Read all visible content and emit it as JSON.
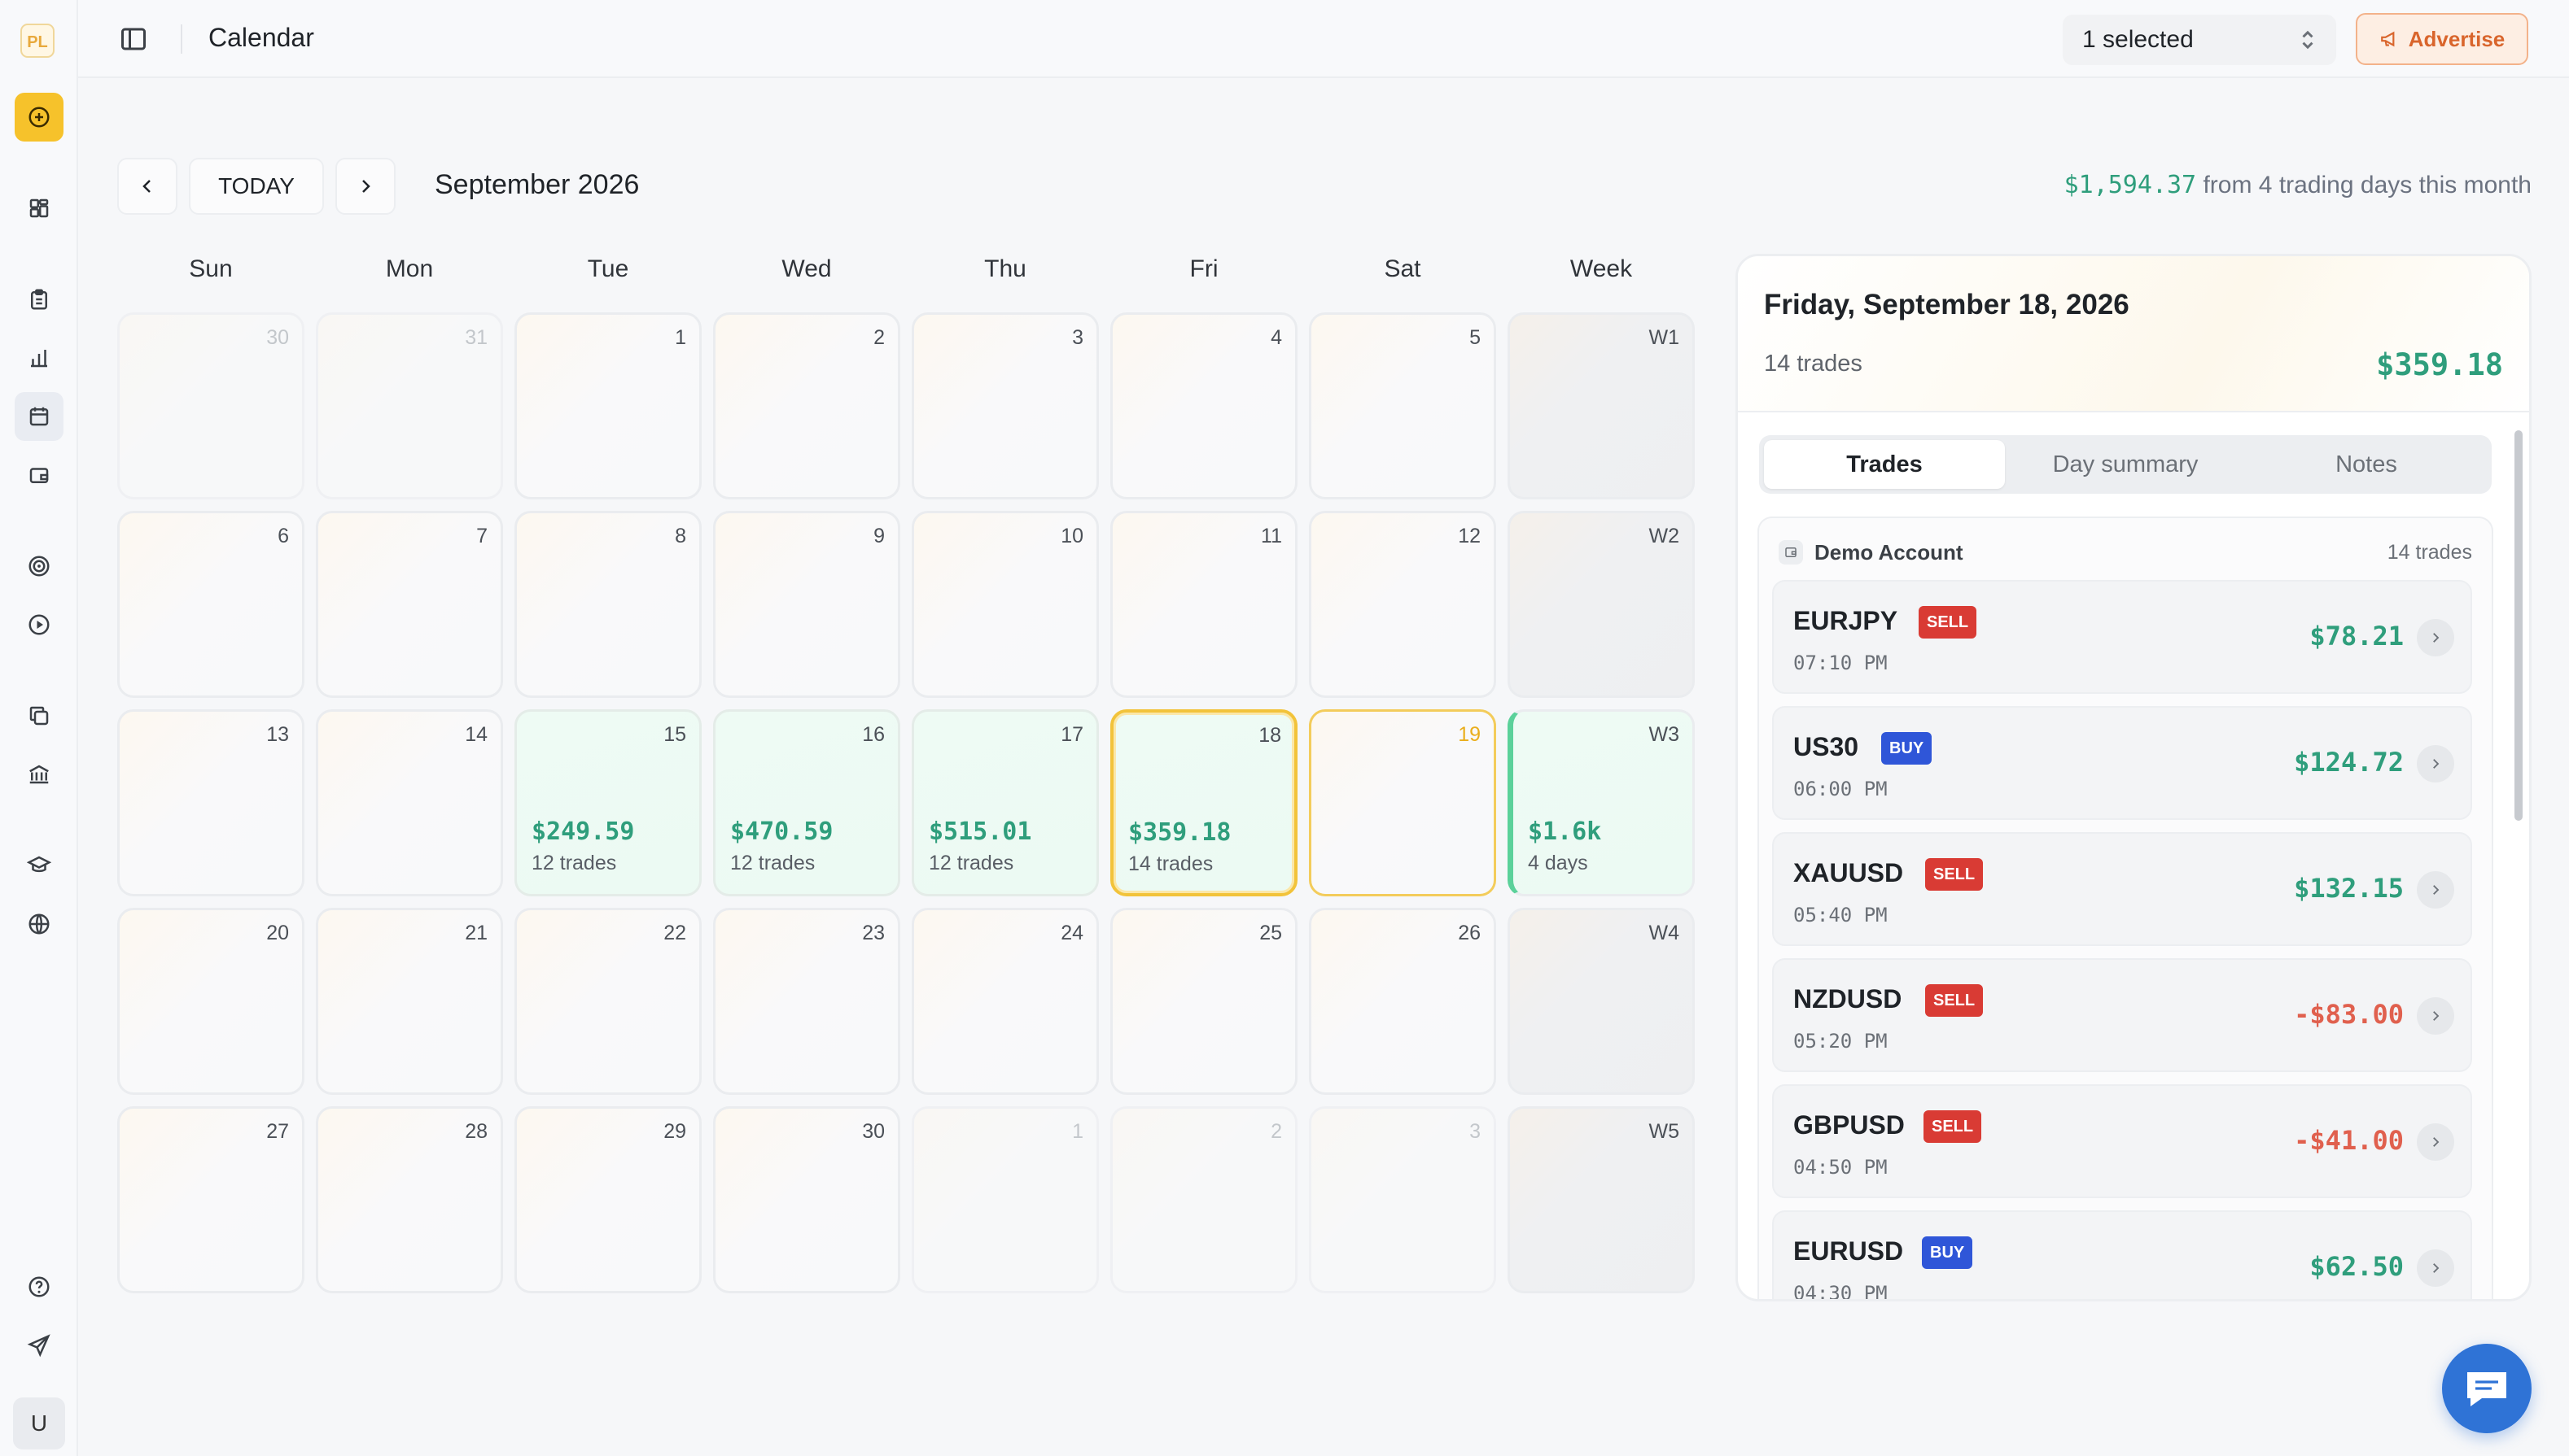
{
  "app": {
    "logo": "PL",
    "user_initial": "U"
  },
  "topbar": {
    "title": "Calendar",
    "account_select": "1 selected",
    "advertise_label": "Advertise"
  },
  "calendar": {
    "today_label": "TODAY",
    "month": "September 2026",
    "summary_amount": "$1,594.37",
    "summary_text": "from 4 trading days this month",
    "weekdays": [
      "Sun",
      "Mon",
      "Tue",
      "Wed",
      "Thu",
      "Fri",
      "Sat",
      "Week"
    ],
    "weeks": [
      {
        "days": [
          {
            "n": "30",
            "faded": true
          },
          {
            "n": "31",
            "faded": true
          },
          {
            "n": "1"
          },
          {
            "n": "2"
          },
          {
            "n": "3"
          },
          {
            "n": "4"
          },
          {
            "n": "5"
          }
        ],
        "label": "W1"
      },
      {
        "days": [
          {
            "n": "6"
          },
          {
            "n": "7"
          },
          {
            "n": "8"
          },
          {
            "n": "9"
          },
          {
            "n": "10"
          },
          {
            "n": "11"
          },
          {
            "n": "12"
          }
        ],
        "label": "W2"
      },
      {
        "days": [
          {
            "n": "13"
          },
          {
            "n": "14"
          },
          {
            "n": "15",
            "pnl": "$249.59",
            "trades": "12 trades"
          },
          {
            "n": "16",
            "pnl": "$470.59",
            "trades": "12 trades"
          },
          {
            "n": "17",
            "pnl": "$515.01",
            "trades": "12 trades"
          },
          {
            "n": "18",
            "pnl": "$359.18",
            "trades": "14 trades",
            "selected": true
          },
          {
            "n": "19",
            "today": true
          }
        ],
        "label": "W3",
        "week_pnl": "$1.6k",
        "week_days": "4 days"
      },
      {
        "days": [
          {
            "n": "20"
          },
          {
            "n": "21"
          },
          {
            "n": "22"
          },
          {
            "n": "23"
          },
          {
            "n": "24"
          },
          {
            "n": "25"
          },
          {
            "n": "26"
          }
        ],
        "label": "W4"
      },
      {
        "days": [
          {
            "n": "27"
          },
          {
            "n": "28"
          },
          {
            "n": "29"
          },
          {
            "n": "30"
          },
          {
            "n": "1",
            "faded": true
          },
          {
            "n": "2",
            "faded": true
          },
          {
            "n": "3",
            "faded": true
          }
        ],
        "label": "W5"
      }
    ]
  },
  "panel": {
    "date": "Friday, September 18, 2026",
    "trades_count": "14 trades",
    "pnl": "$359.18",
    "tabs": [
      "Trades",
      "Day summary",
      "Notes"
    ],
    "account": {
      "name": "Demo Account",
      "count": "14 trades"
    },
    "trades": [
      {
        "symbol": "EURJPY",
        "side": "SELL",
        "time": "07:10 PM",
        "pnl": "$78.21",
        "positive": true
      },
      {
        "symbol": "US30",
        "side": "BUY",
        "time": "06:00 PM",
        "pnl": "$124.72",
        "positive": true
      },
      {
        "symbol": "XAUUSD",
        "side": "SELL",
        "time": "05:40 PM",
        "pnl": "$132.15",
        "positive": true
      },
      {
        "symbol": "NZDUSD",
        "side": "SELL",
        "time": "05:20 PM",
        "pnl": "-$83.00",
        "positive": false
      },
      {
        "symbol": "GBPUSD",
        "side": "SELL",
        "time": "04:50 PM",
        "pnl": "-$41.00",
        "positive": false
      },
      {
        "symbol": "EURUSD",
        "side": "BUY",
        "time": "04:30 PM",
        "pnl": "$62.50",
        "positive": true
      }
    ]
  },
  "icons": {
    "sidebar": [
      "add-circle-icon",
      "dashboard-icon",
      "clipboard-icon",
      "bar-chart-icon",
      "calendar-icon",
      "wallet-icon",
      "target-icon",
      "play-icon",
      "copy-icon",
      "bank-icon",
      "graduation-cap-icon",
      "globe-icon",
      "help-icon",
      "send-icon"
    ]
  },
  "colors": {
    "profit": "#2f9e7c",
    "loss": "#e0604e",
    "accent": "#f6c22b",
    "sell": "#d93b34",
    "buy": "#2f56d8"
  }
}
